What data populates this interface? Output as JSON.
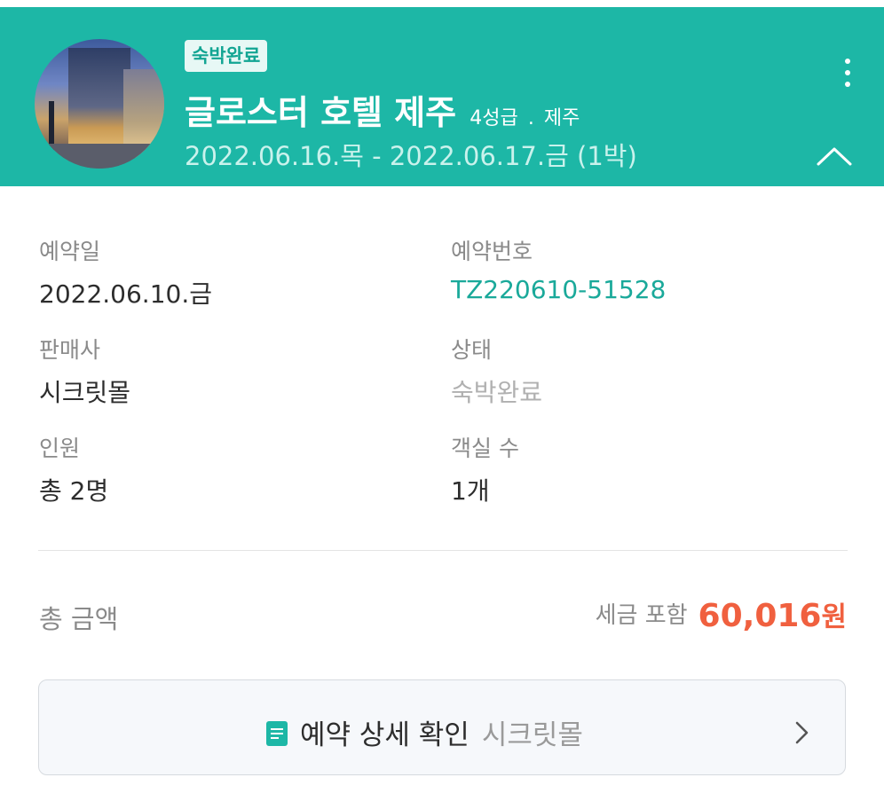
{
  "header": {
    "status_badge": "숙박완료",
    "hotel_name": "글로스터 호텔 제주",
    "grade": "4성급",
    "separator": ".",
    "region": "제주",
    "dates": "2022.06.16.목 - 2022.06.17.금 (1박)",
    "bg_color": "#1db7a6"
  },
  "info": {
    "booking_date_label": "예약일",
    "booking_date": "2022.06.10.금",
    "booking_no_label": "예약번호",
    "booking_no": "TZ220610-51528",
    "seller_label": "판매사",
    "seller": "시크릿몰",
    "status_label": "상태",
    "status": "숙박완료",
    "guests_label": "인원",
    "guests": "총 2명",
    "rooms_label": "객실 수",
    "rooms": "1개"
  },
  "total": {
    "label": "총 금액",
    "tax_label": "세금 포함",
    "amount": "60,016",
    "currency": "원",
    "amount_color": "#f0603f"
  },
  "detail_button": {
    "label": "예약 상세 확인",
    "sub": "시크릿몰"
  },
  "icons": [
    "hotel-photo",
    "more-vertical-icon",
    "chevron-up-icon",
    "document-icon",
    "chevron-right-icon"
  ]
}
